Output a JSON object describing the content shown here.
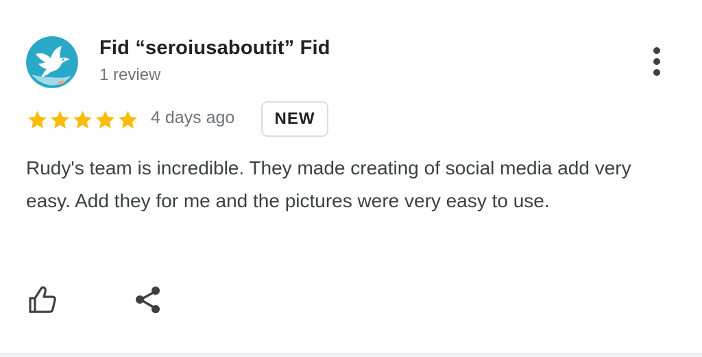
{
  "review": {
    "author_name": "Fid “seroiusaboutit” Fid",
    "review_count": "1 review",
    "rating": 5,
    "rating_max": 5,
    "date": "4 days ago",
    "badge": "NEW",
    "text": "Rudy's team is incredible. They made creating of social media add very easy. Add they for me and the pictures were very easy to use."
  },
  "icons": {
    "avatar": "bird-avatar-icon",
    "more": "more-vert-icon",
    "like": "thumb-up-icon",
    "share": "share-icon",
    "star": "star-icon"
  },
  "colors": {
    "star": "#fbbc04",
    "avatar_bg": "#2aa8c7",
    "secondary_text": "#70757a",
    "primary_text": "#202124",
    "badge_border": "#dadce0"
  }
}
